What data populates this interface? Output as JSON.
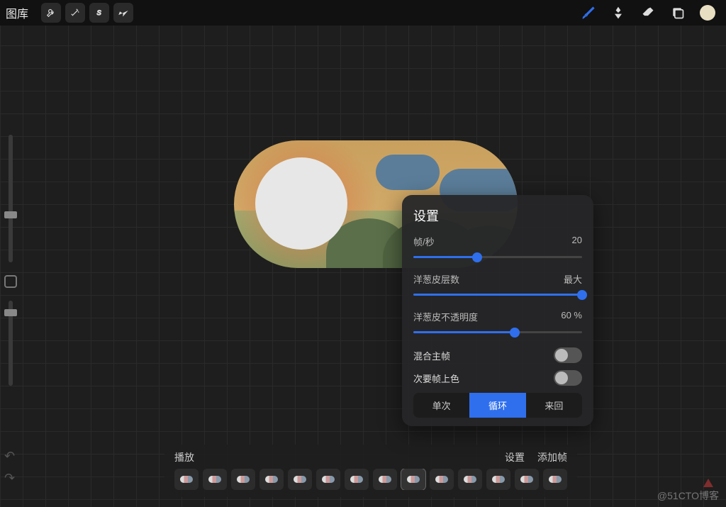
{
  "toolbar": {
    "gallery_label": "图库",
    "left_tools": [
      "wrench-icon",
      "wand-icon",
      "s-icon",
      "arrow-icon"
    ],
    "right_tools": [
      "brush-icon",
      "eyedropper-icon",
      "eraser-icon",
      "layers-icon",
      "color-swatch"
    ]
  },
  "side": {
    "slider1_pos_pct": 60,
    "slider2_pos_pct": 10
  },
  "popover": {
    "title": "设置",
    "fps_label": "帧/秒",
    "fps_value": "20",
    "fps_pct": 38,
    "onion_layers_label": "洋葱皮层数",
    "onion_layers_value": "最大",
    "onion_layers_pct": 100,
    "onion_opacity_label": "洋葱皮不透明度",
    "onion_opacity_value": "60 %",
    "onion_opacity_pct": 60,
    "blend_primary_label": "混合主帧",
    "blend_primary_on": false,
    "color_secondary_label": "次要帧上色",
    "color_secondary_on": false,
    "seg_once": "单次",
    "seg_loop": "循环",
    "seg_pingpong": "来回",
    "seg_active": "循环"
  },
  "timeline": {
    "play_label": "播放",
    "settings_label": "设置",
    "add_frame_label": "添加帧",
    "frame_count": 14,
    "selected_index": 8
  },
  "watermark": "@51CTO博客",
  "colors": {
    "accent": "#2f6fed",
    "swatch": "#e8dfc3"
  }
}
